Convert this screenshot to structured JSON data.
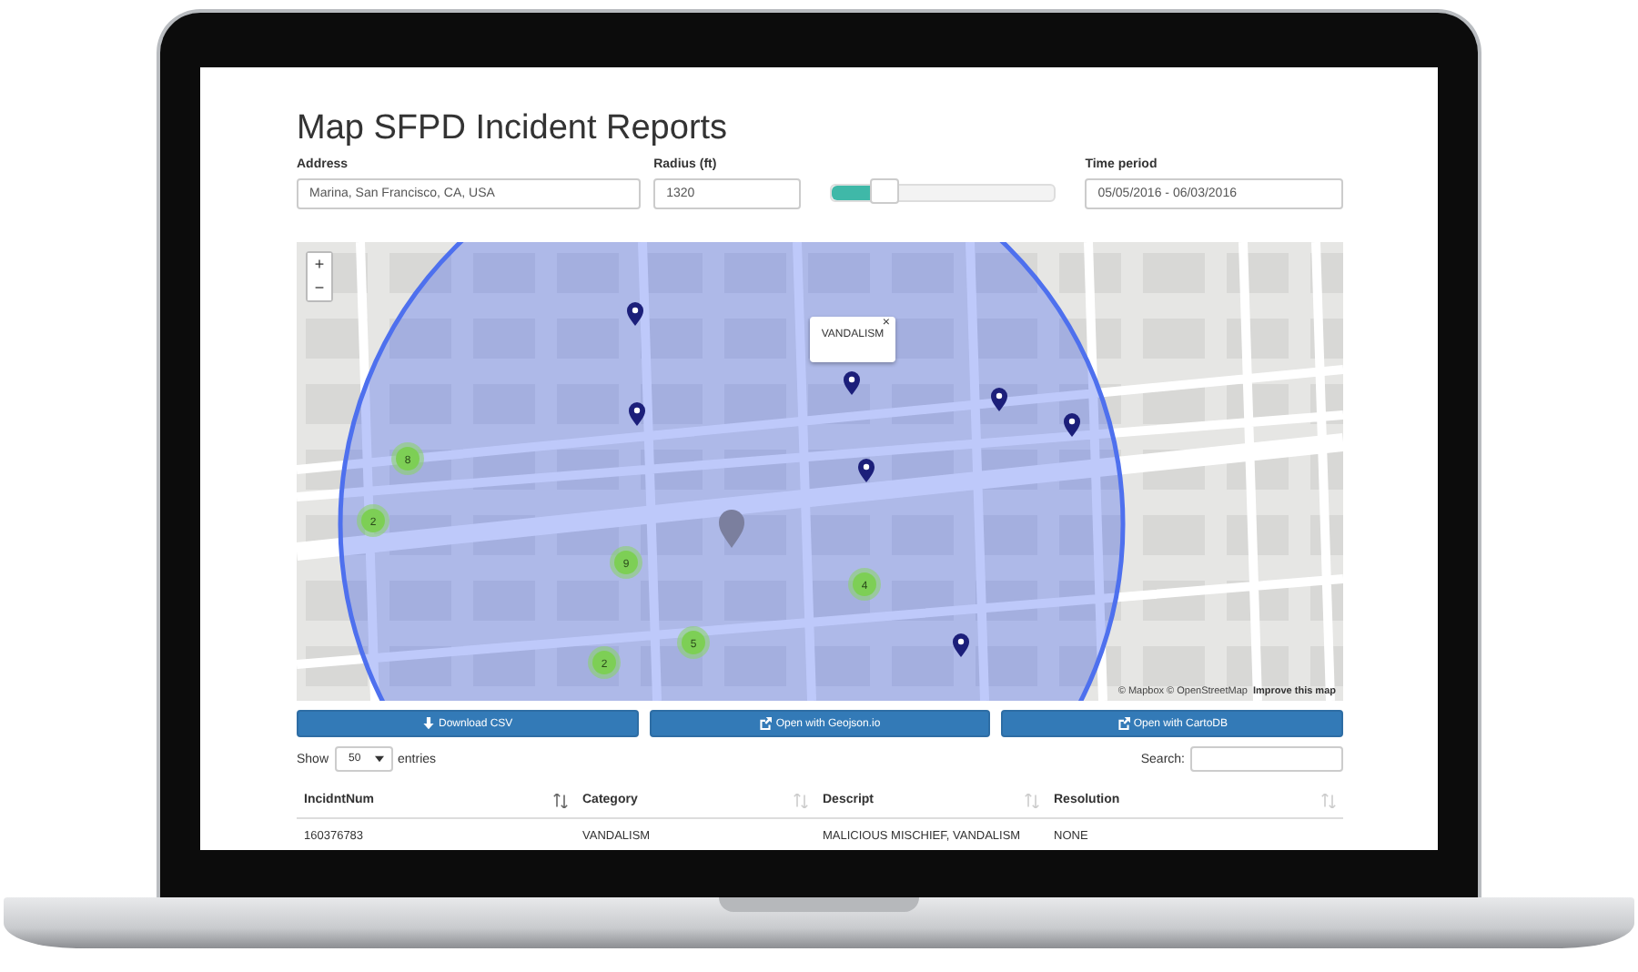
{
  "page": {
    "title": "Map SFPD Incident Reports"
  },
  "filters": {
    "address": {
      "label": "Address",
      "value": "Marina, San Francisco, CA, USA"
    },
    "radius": {
      "label": "Radius (ft)",
      "value": "1320",
      "level": 0.25
    },
    "time_period": {
      "label": "Time period",
      "value": "05/05/2016 - 06/03/2016"
    }
  },
  "map": {
    "zoom_in": "+",
    "zoom_out": "−",
    "popup": {
      "close": "×",
      "text": "VANDALISM"
    },
    "clusters": [
      {
        "count": "8"
      },
      {
        "count": "2"
      },
      {
        "count": "9"
      },
      {
        "count": "4"
      },
      {
        "count": "5"
      },
      {
        "count": "2"
      }
    ],
    "attribution": {
      "text": "© Mapbox © OpenStreetMap",
      "link": "Improve this map"
    }
  },
  "buttons": [
    {
      "kind": "download",
      "label": "Download CSV"
    },
    {
      "kind": "external",
      "label": "Open with Geojson.io"
    },
    {
      "kind": "external",
      "label": "Open with CartoDB"
    }
  ],
  "table_controls": {
    "show": "Show",
    "page_size": "50",
    "entries": "entries",
    "search_label": "Search:"
  },
  "table": {
    "columns": [
      {
        "label": "IncidntNum",
        "sorted": true
      },
      {
        "label": "Category",
        "sorted": false
      },
      {
        "label": "Descript",
        "sorted": false
      },
      {
        "label": "Resolution",
        "sorted": false
      }
    ],
    "rows": [
      [
        "160376783",
        "VANDALISM",
        "MALICIOUS MISCHIEF, VANDALISM",
        "NONE"
      ]
    ]
  }
}
